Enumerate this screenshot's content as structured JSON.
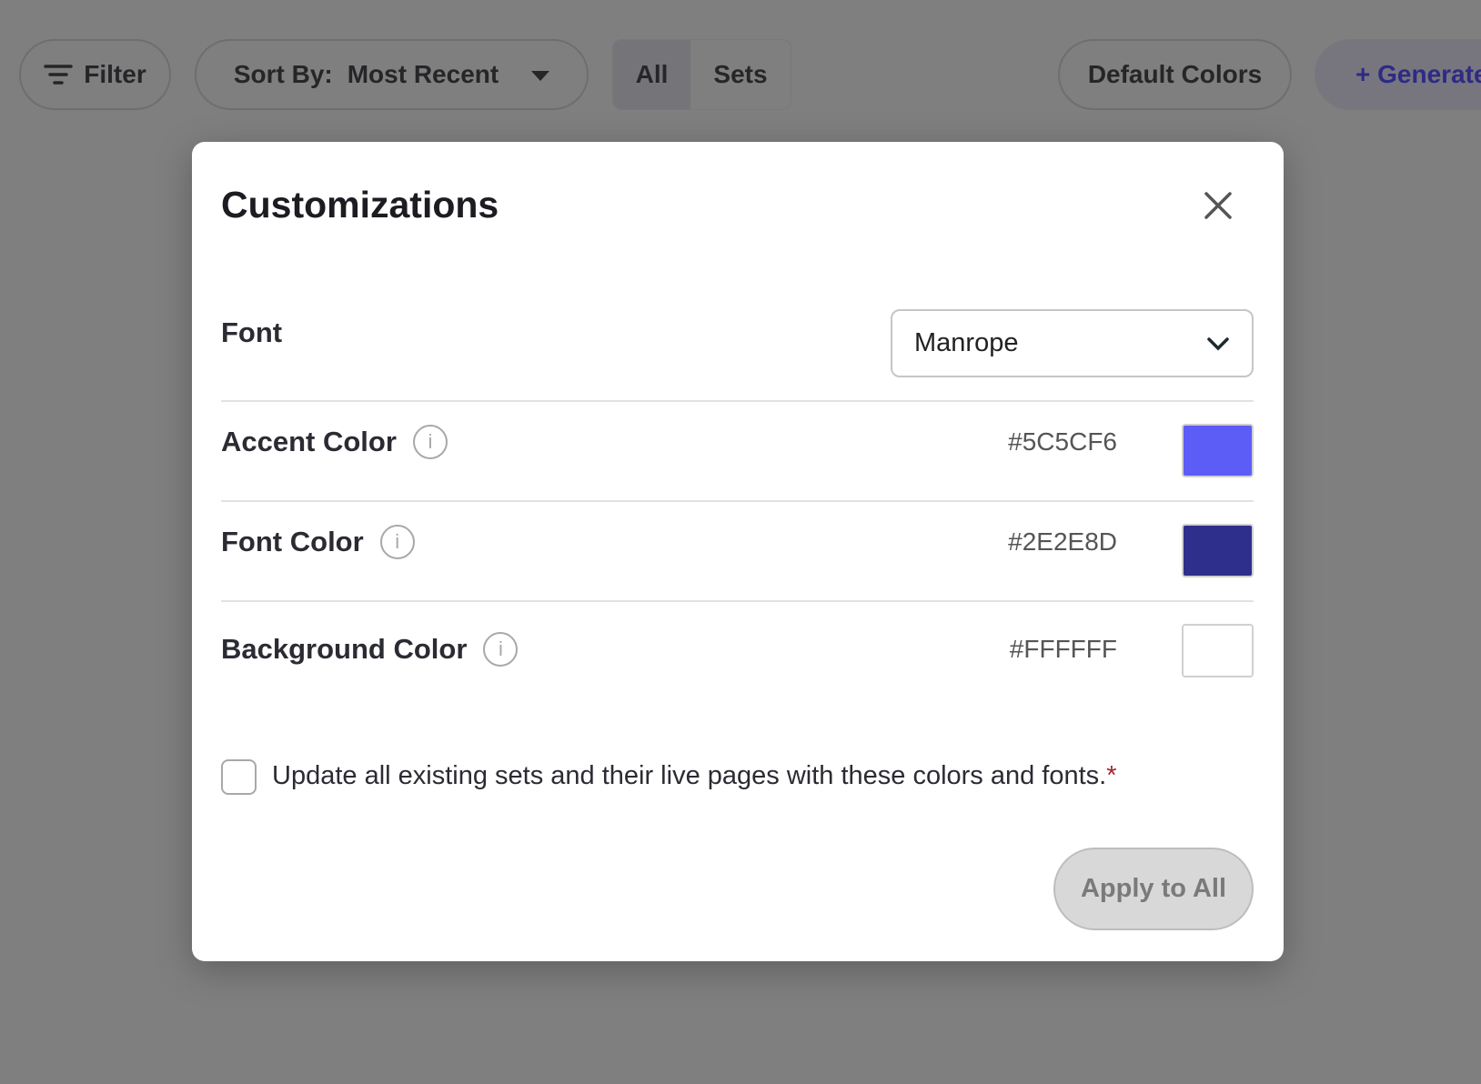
{
  "toolbar": {
    "filter_label": "Filter",
    "sort_prefix": "Sort By:",
    "sort_value": "Most Recent",
    "tabs": [
      "All",
      "Sets"
    ],
    "default_colors_label": "Default Colors",
    "generate_label": "+ Generate"
  },
  "modal": {
    "title": "Customizations",
    "font": {
      "label": "Font",
      "value": "Manrope"
    },
    "accent": {
      "label": "Accent Color",
      "hex": "#5C5CF6",
      "color": "#5C5CF6"
    },
    "font_color": {
      "label": "Font Color",
      "hex": "#2E2E8D",
      "color": "#2E2E8D"
    },
    "background": {
      "label": "Background Color",
      "hex": "#FFFFFF",
      "color": "#FFFFFF"
    },
    "info_glyph": "i",
    "update_all": {
      "label": "Update all existing sets and their live pages with these colors and fonts.",
      "required_mark": "*",
      "checked": false
    },
    "apply_label": "Apply to All"
  }
}
